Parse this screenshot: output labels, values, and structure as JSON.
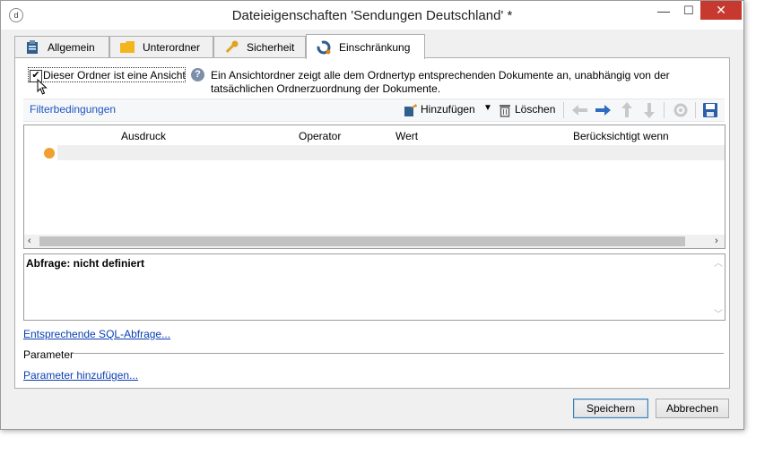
{
  "window": {
    "title": "Dateieigenschaften 'Sendungen Deutschland' *",
    "controls": {
      "minimize": "—",
      "maximize": "☐",
      "close": "✕"
    }
  },
  "tabs": [
    {
      "label": "Allgemein",
      "icon": "clipboard-icon"
    },
    {
      "label": "Unterordner",
      "icon": "folder-icon"
    },
    {
      "label": "Sicherheit",
      "icon": "key-icon"
    },
    {
      "label": "Einschränkung",
      "icon": "restriction-icon",
      "active": true
    }
  ],
  "view_option": {
    "checkbox_label": "Dieser Ordner ist eine Ansicht",
    "checked": true,
    "info_line1": "Ein Ansichtordner zeigt alle dem Ordnertyp entsprechenden Dokumente an, unabhängig von der",
    "info_line2": "tatsächlichen Ordnerzuordnung der Dokumente."
  },
  "filter": {
    "title": "Filterbedingungen",
    "add_label": "Hinzufügen",
    "delete_label": "Löschen",
    "columns": [
      "Ausdruck",
      "Operator",
      "Wert",
      "Berücksichtigt wenn"
    ]
  },
  "query": {
    "text": "Abfrage: nicht definiert"
  },
  "links": {
    "sql": "Entsprechende SQL-Abfrage...",
    "add_param": "Parameter hinzufügen..."
  },
  "parameter_label": "Parameter",
  "buttons": {
    "save": "Speichern",
    "cancel": "Abbrechen"
  },
  "colors": {
    "accent": "#1c56c2",
    "close": "#c7392f",
    "active_dot": "#f0a030"
  }
}
